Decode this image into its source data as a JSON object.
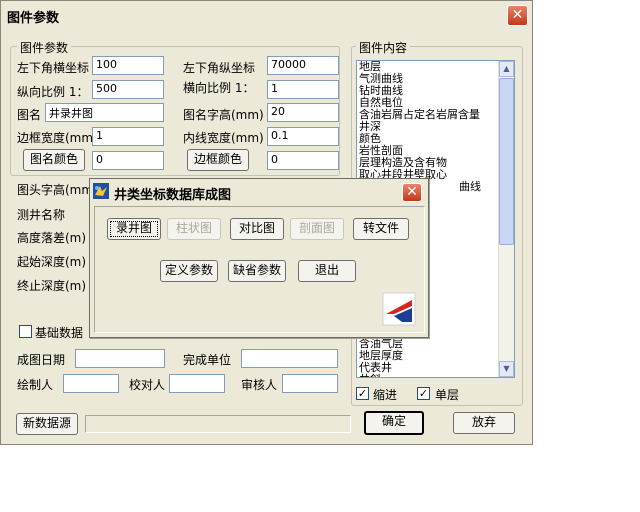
{
  "window": {
    "title": "图件参数",
    "close_glyph": "✕"
  },
  "left_group": {
    "legend": "图件参数",
    "row1": {
      "label_a": "左下角横坐标",
      "value_a": "100",
      "label_b": "左下角纵坐标",
      "value_b": "70000"
    },
    "row2": {
      "label_a": "纵向比例 1：",
      "value_a": "500",
      "label_b": "横向比例 1：",
      "value_b": "1"
    },
    "row3": {
      "label_a": "图名",
      "value_a": "井录井图",
      "label_b": "图名字高(mm)",
      "value_b": "20"
    },
    "row4": {
      "label_a": "边框宽度(mm)",
      "value_a": "1",
      "label_b": "内线宽度(mm)",
      "value_b": "0.1"
    },
    "row5": {
      "button_a": "图名颜色",
      "value_a": "0",
      "button_b": "边框颜色",
      "value_b": "0"
    }
  },
  "lower_labels": {
    "header_height": "图头字高(mm)",
    "well_name": "测井名称",
    "height_drop": "高度落差(m)",
    "start_depth": "起始深度(m)",
    "end_depth": "终止深度(m)",
    "basic_data": "基础数据"
  },
  "footer_fields": {
    "date_label": "成图日期",
    "date_value": "",
    "unit_label": "完成单位",
    "unit_value": "",
    "drawer_label": "绘制人",
    "drawer_value": "",
    "checker_label": "校对人",
    "checker_value": "",
    "reviewer_label": "审核人",
    "reviewer_value": ""
  },
  "right_group": {
    "legend": "图件内容",
    "items_top": [
      "地层",
      "气测曲线",
      "钻时曲线",
      "自然电位",
      "含油岩屑占定名岩屑含量",
      "井深",
      "颜色",
      "岩性剖面",
      "层理构造及含有物",
      "取心井段井壁取心"
    ],
    "partial_item": "曲线",
    "items_bottom": [
      "含油气层",
      "地层厚度",
      "代表井",
      "井斜"
    ],
    "checkbox_indent": {
      "label": "缩进",
      "checked": true
    },
    "checkbox_single": {
      "label": "单层",
      "checked": true
    }
  },
  "bottom_bar": {
    "new_source_button": "新数据源",
    "ok_button": "确定",
    "cancel_button": "放弃"
  },
  "dialog": {
    "title": "井类坐标数据库成图",
    "close_glyph": "✕",
    "buttons_row1": [
      {
        "label": "录井图",
        "enabled": true
      },
      {
        "label": "柱状图",
        "enabled": false
      },
      {
        "label": "对比图",
        "enabled": true
      },
      {
        "label": "剖面图",
        "enabled": false
      },
      {
        "label": "转文件",
        "enabled": true
      }
    ],
    "buttons_row2": [
      {
        "label": "定义参数"
      },
      {
        "label": "缺省参数"
      },
      {
        "label": "退出"
      }
    ]
  }
}
